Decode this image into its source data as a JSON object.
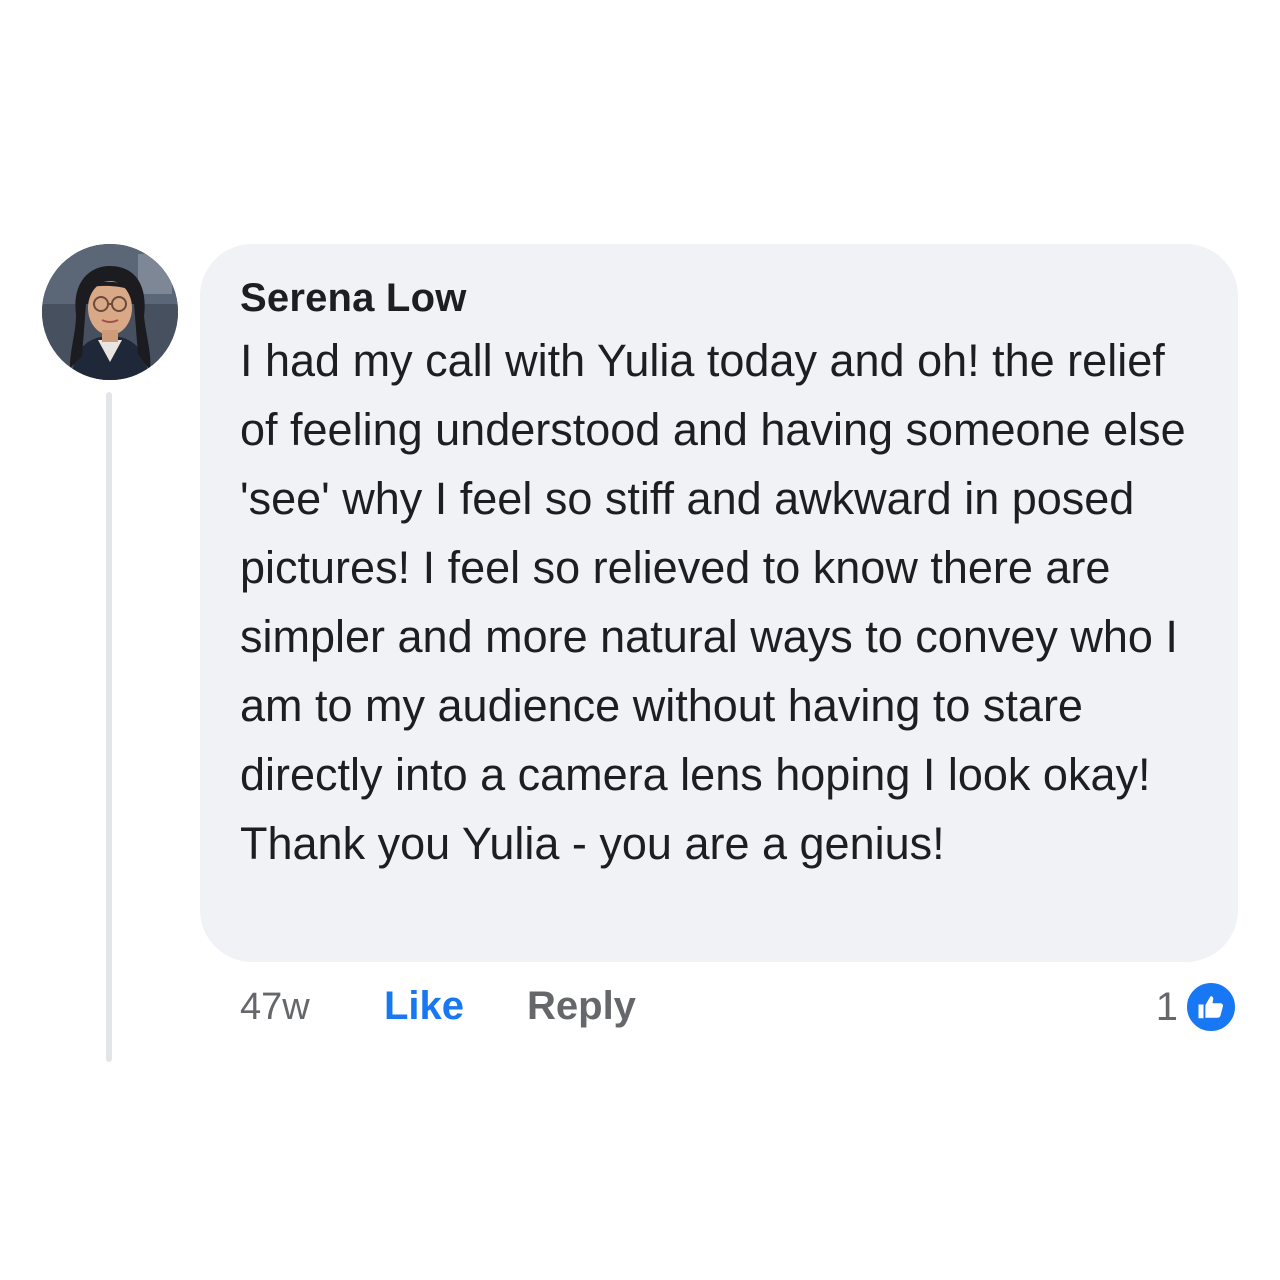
{
  "comment": {
    "author": "Serena Low",
    "text": "I had my call with Yulia today and oh! the relief of feeling understood and having someone else 'see' why I feel so stiff and awkward in posed pictures! I feel so relieved to know there are simpler and more natural ways to convey who I am to my audience without having to stare directly into a camera lens hoping I look okay! Thank you Yulia - you are a genius!",
    "avatar_icon": "profile-photo"
  },
  "meta": {
    "time": "47w",
    "like_label": "Like",
    "reply_label": "Reply",
    "reaction_count": "1",
    "reaction_icon": "thumbs-up-icon"
  },
  "colors": {
    "bubble": "#f0f2f5",
    "like_blue": "#1877f2",
    "secondary_text": "#65676b",
    "thread_line": "#e3e5e9"
  }
}
